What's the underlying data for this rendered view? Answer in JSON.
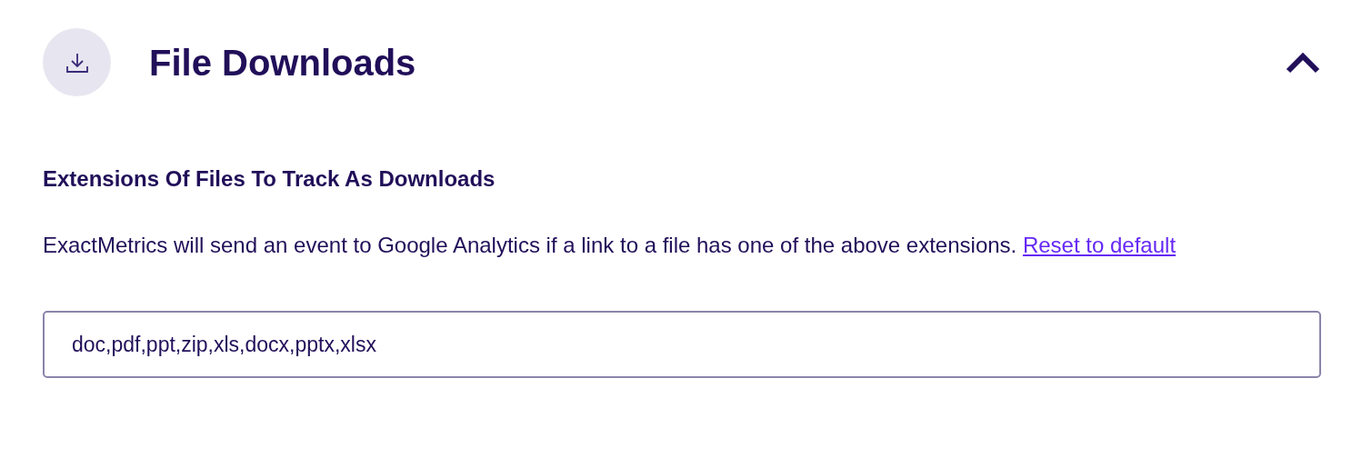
{
  "section": {
    "title": "File Downloads",
    "expanded": true
  },
  "field": {
    "label": "Extensions Of Files To Track As Downloads",
    "description": "ExactMetrics will send an event to Google Analytics if a link to a file has one of the above extensions.",
    "link": "Reset to default",
    "value": "doc,pdf,ppt,zip,xls,docx,pptx,xlsx"
  }
}
